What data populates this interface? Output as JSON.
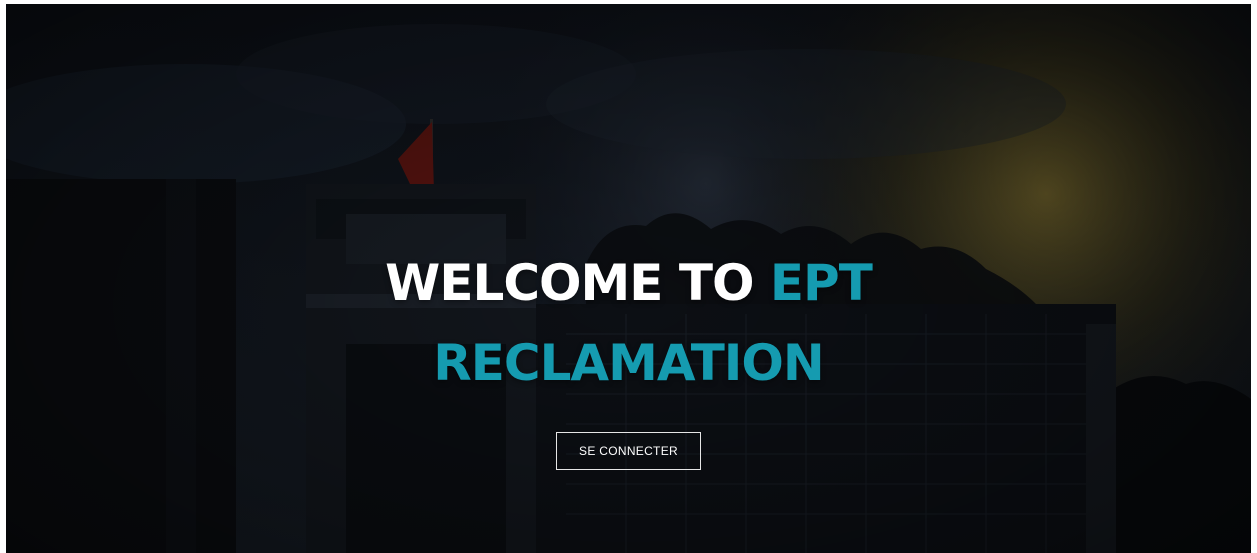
{
  "hero": {
    "title_white": "WELCOME TO",
    "title_accent_1": "EPT",
    "title_accent_2": "RECLAMATION",
    "cta_label": "SE CONNECTER"
  },
  "colors": {
    "accent": "#159bb0",
    "text": "#ffffff",
    "background": "#0b0e14"
  }
}
